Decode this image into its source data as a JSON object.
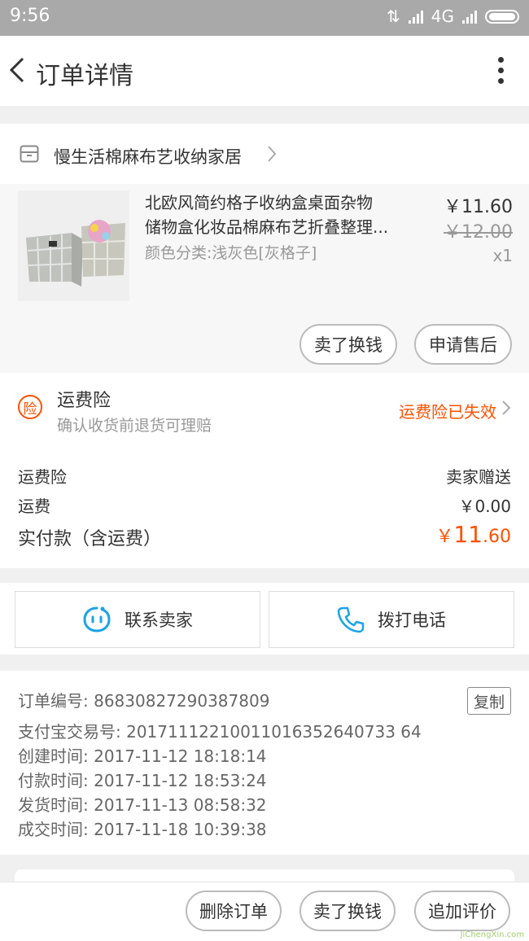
{
  "status_bar": {
    "time": "9:56",
    "network": "4G"
  },
  "header": {
    "title": "订单详情"
  },
  "store": {
    "name": "慢生活棉麻布艺收纳家居"
  },
  "product": {
    "title_line1": "北欧风简约格子收纳盒桌面杂物",
    "title_line2": "储物盒化妆品棉麻布艺折叠整理...",
    "sku": "颜色分类:浅灰色[灰格子]",
    "price": "￥11.60",
    "original_price": "￥12.00",
    "quantity": "x1",
    "buttons": [
      "卖了换钱",
      "申请售后"
    ]
  },
  "insurance": {
    "badge": "险",
    "title": "运费险",
    "subtitle": "确认收货前退货可理赔",
    "status": "运费险已失效"
  },
  "summary": {
    "rows": [
      {
        "label": "运费险",
        "value": "卖家赠送"
      },
      {
        "label": "运费",
        "value": "￥0.00"
      }
    ],
    "total_label": "实付款（含运费）",
    "total_symbol": "￥",
    "total_int": "11",
    "total_dec": ".60"
  },
  "contact": {
    "seller": "联系卖家",
    "phone": "拨打电话"
  },
  "order_info": {
    "order_no_label": "订单编号:",
    "order_no": "86830827290387809",
    "copy": "复制",
    "alipay_label": "支付宝交易号:",
    "alipay_no": "20171112210011016352640733 64",
    "created_label": "创建时间:",
    "created": "2017-11-12 18:18:14",
    "paid_label": "付款时间:",
    "paid": "2017-11-12 18:53:24",
    "shipped_label": "发货时间:",
    "shipped": "2017-11-13 08:58:32",
    "completed_label": "成交时间:",
    "completed": "2017-11-18 10:39:38"
  },
  "bottom_bar": {
    "buttons": [
      "删除订单",
      "卖了换钱",
      "追加评价"
    ]
  },
  "watermark": {
    "text": "JiChengXin.com"
  },
  "colors": {
    "accent": "#ff5000",
    "contact_icon": "#1aa3e8"
  }
}
